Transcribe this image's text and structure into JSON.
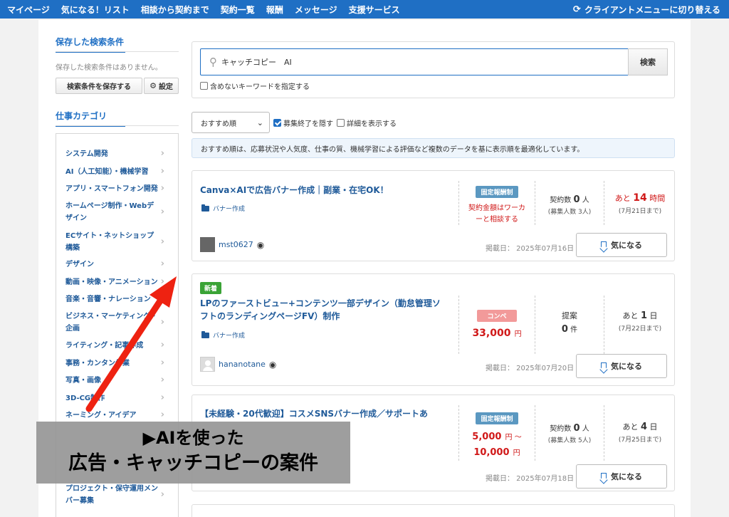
{
  "nav": {
    "items": [
      "マイページ",
      "気になる！リスト",
      "相談から契約まで",
      "契約一覧",
      "報酬",
      "メッセージ",
      "支援サービス"
    ],
    "switch_label": "クライアントメニューに切り替える"
  },
  "sidebar": {
    "saved_title": "保存した検索条件",
    "saved_empty": "保存した検索条件はありません。",
    "save_button": "検索条件を保存する",
    "settings_button": "設定",
    "category_title": "仕事カテゴリ",
    "categories": [
      "システム開発",
      "AI（人工知能）・機械学習",
      "アプリ・スマートフォン開発",
      "ホームページ制作・Webデザイン",
      "ECサイト・ネットショップ構築",
      "デザイン",
      "動画・映像・アニメーション",
      "音楽・音響・ナレーション",
      "ビジネス・マーケティング・企画",
      "ライティング・記事作成",
      "事務・カンタン作業",
      "写真・画像",
      "3D-CG制作",
      "ネーミング・アイデア",
      "プロジェクト・保守運用メンバー募集"
    ]
  },
  "search": {
    "query": "キャッチコピー　AI",
    "button": "検索",
    "exclude_label": "含めないキーワードを指定する"
  },
  "filters": {
    "sort_selected": "おすすめ順",
    "hide_closed_label": "募集終了を隠す",
    "hide_closed_checked": true,
    "show_details_label": "詳細を表示する",
    "show_details_checked": false,
    "info": "おすすめ順は、応募状況や人気度、仕事の質、機械学習による評価など複数のデータを基に表示順を最適化しています。"
  },
  "jobs": [
    {
      "title": "Canva×AIで広告バナー作成｜副業・在宅OK！",
      "category": "バナー作成",
      "badge": "固定報酬制",
      "price_line1": "契約金額はワーカ",
      "price_line2": "ーと相談する",
      "stat_label": "契約数",
      "stat_value": "0",
      "stat_unit": "人",
      "stat_sub": "(募集人数 3人)",
      "remain_prefix": "あと",
      "remain_value": "14",
      "remain_unit": "時間",
      "deadline": "(7月21日まで)",
      "user": "mst0627",
      "posted": "掲載日：  2025年07月16日",
      "fav": "気になる"
    },
    {
      "new_badge": "新着",
      "title_line1": "LPのファーストビュー+コンテンツ一部デザイン（勤怠管理ソ",
      "title_line2": "フトのランディングページFV）制作",
      "category": "バナー作成",
      "badge": "コンペ",
      "price": "33,000",
      "price_unit": "円",
      "stat_label": "提案",
      "stat_value": "0",
      "stat_unit": "件",
      "remain_prefix": "あと",
      "remain_value": "1",
      "remain_unit": "日",
      "deadline": "(7月22日まで)",
      "user": "hananotane",
      "posted": "掲載日：  2025年07月20日",
      "fav": "気になる"
    },
    {
      "title": "【未経験・20代歓迎】コスメSNSバナー作成／サポートあ",
      "badge": "固定報酬制",
      "price_low": "5,000",
      "price_low_unit": "円 ～",
      "price_high": "10,000",
      "price_high_unit": "円",
      "stat_label": "契約数",
      "stat_value": "0",
      "stat_unit": "人",
      "stat_sub": "(募集人数 5人)",
      "remain_prefix": "あと",
      "remain_value": "4",
      "remain_unit": "日",
      "deadline": "(7月25日まで)",
      "posted": "掲載日：  2025年07月18日",
      "fav": "気になる"
    }
  ],
  "overlay": {
    "line1": "▶AIを使った",
    "line2": "広告・キャッチコピーの案件"
  },
  "colors": {
    "nav_bg": "#1f6fc4",
    "link": "#1f5a99",
    "accent_red": "#d01818",
    "arrow": "#ee2211"
  }
}
